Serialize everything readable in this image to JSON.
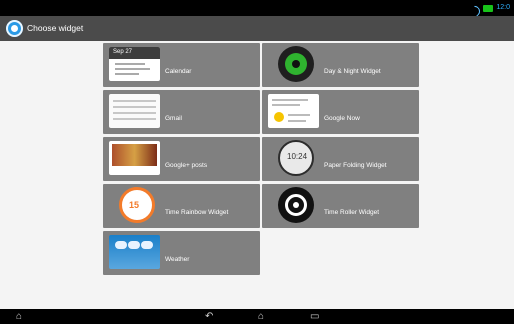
{
  "status": {
    "time": "12:0"
  },
  "actionbar": {
    "title": "Choose widget",
    "icon": "settings-gear-icon"
  },
  "widgets": [
    {
      "label": "Calendar",
      "thumb": "calendar-preview"
    },
    {
      "label": "Day & Night Widget",
      "thumb": "day-night-preview"
    },
    {
      "label": "Gmail",
      "thumb": "gmail-preview"
    },
    {
      "label": "Google Now",
      "thumb": "google-now-preview"
    },
    {
      "label": "Google+ posts",
      "thumb": "google-plus-preview"
    },
    {
      "label": "Paper Folding Widget",
      "thumb": "paper-folding-preview"
    },
    {
      "label": "Time Rainbow Widget",
      "thumb": "time-rainbow-preview"
    },
    {
      "label": "Time Roller Widget",
      "thumb": "time-roller-preview"
    },
    {
      "label": "Weather",
      "thumb": "weather-preview"
    }
  ],
  "nav": {
    "home": "home-icon",
    "back": "back-icon",
    "recents": "recent-apps-icon"
  }
}
